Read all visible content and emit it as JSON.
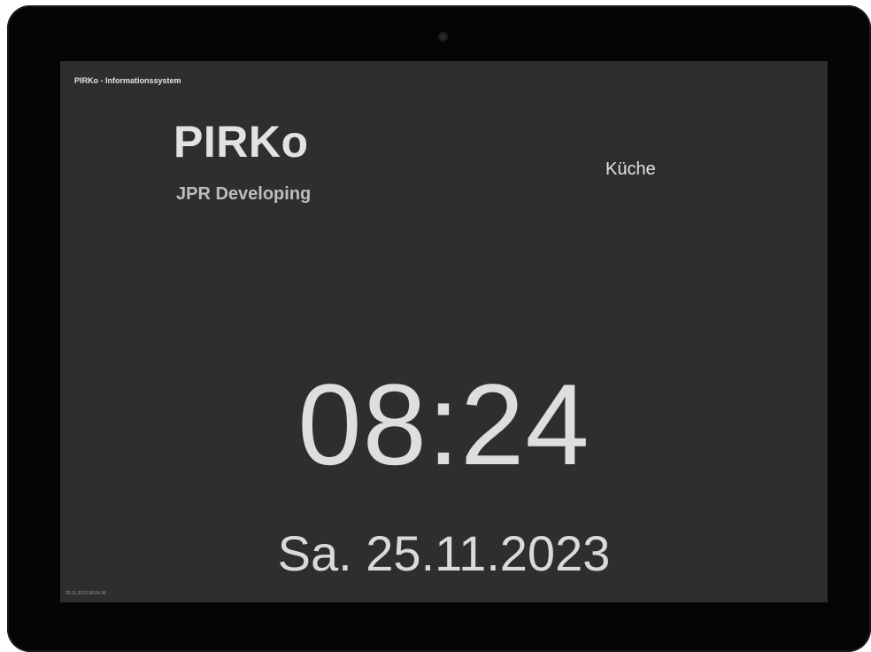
{
  "window": {
    "title": "PIRKo - Informationssystem"
  },
  "brand": {
    "name": "PIRKo",
    "subtitle": "JPR Developing"
  },
  "room": {
    "label": "Küche"
  },
  "clock": {
    "time": "08:24"
  },
  "date": {
    "text": "Sa. 25.11.2023"
  },
  "footer": {
    "timestamp": "25.11.2023 08:24:36"
  }
}
